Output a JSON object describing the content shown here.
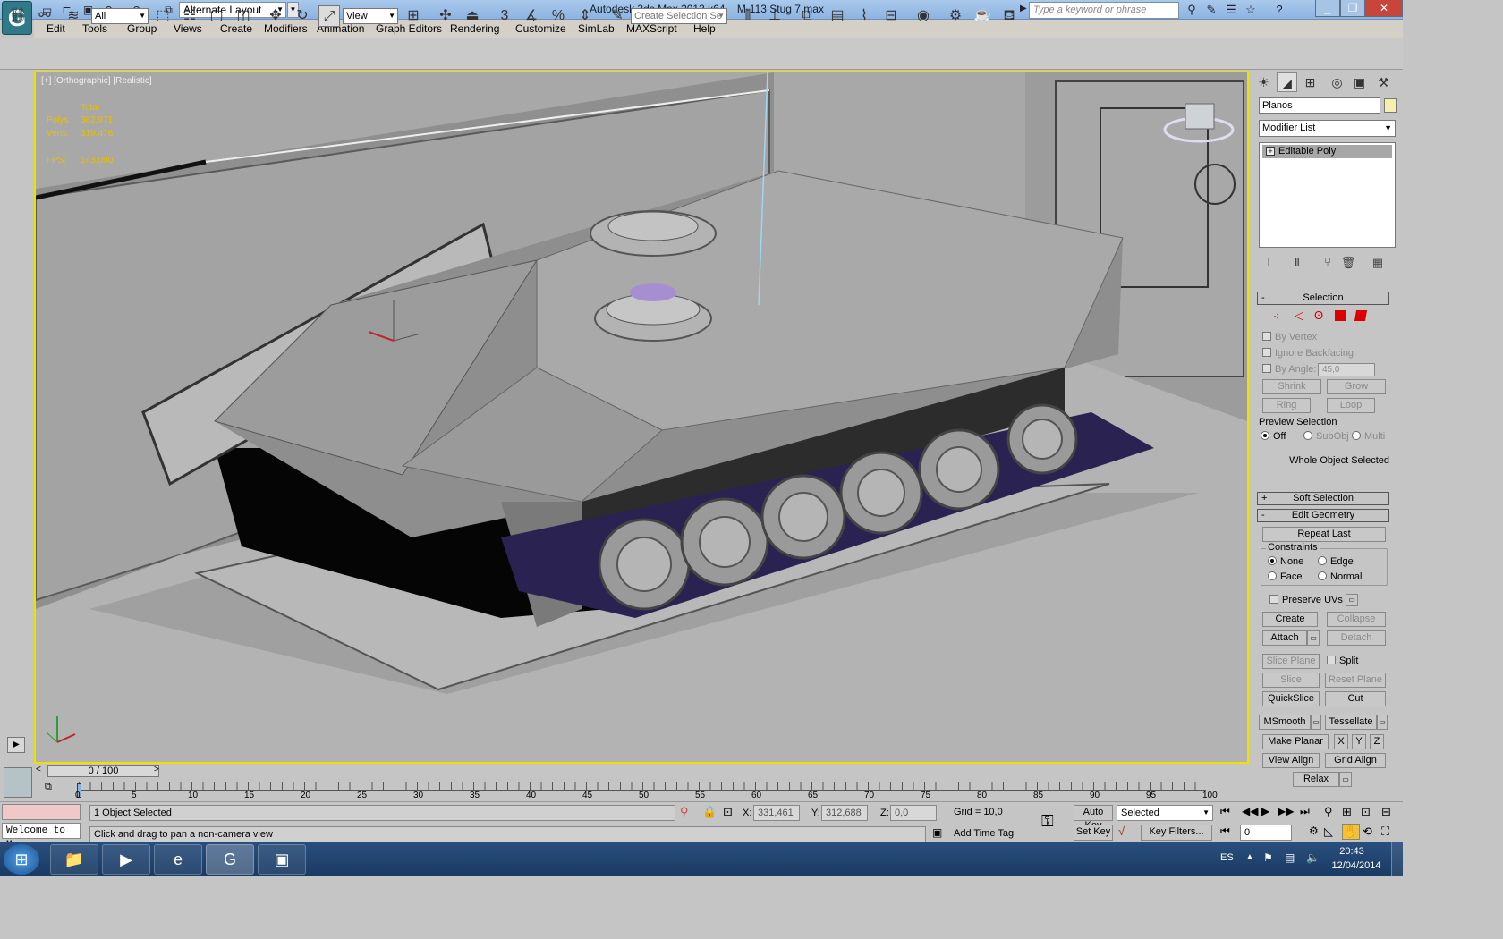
{
  "titlebar": {
    "workspace": "Alternate Layout",
    "app_title": "Autodesk 3ds Max  2013 x64",
    "file_title": "M-113 Stug 7.max",
    "search_placeholder": "Type a keyword or phrase"
  },
  "menu": [
    "Edit",
    "Tools",
    "Group",
    "Views",
    "Create",
    "Modifiers",
    "Animation",
    "Graph Editors",
    "Rendering",
    "Customize",
    "SimLab",
    "MAXScript",
    "Help"
  ],
  "toolbar": {
    "filter": "All",
    "ref_coord": "View",
    "named_selection": "Create Selection Se"
  },
  "viewport": {
    "label": "[+] [Orthographic] [Realistic]",
    "stats": {
      "total_label": "Total",
      "polys_label": "Polys:",
      "polys_value": "362.971",
      "verts_label": "Verts:",
      "verts_value": "319.476",
      "fps_label": "FPS:",
      "fps_value": "143,090"
    }
  },
  "panel": {
    "object_name": "Planos",
    "modifier_list": "Modifier List",
    "stack_item": "Editable Poly",
    "selection": {
      "title": "Selection",
      "by_vertex": "By Vertex",
      "ignore_backfacing": "Ignore Backfacing",
      "by_angle": "By Angle:",
      "angle_value": "45,0",
      "shrink": "Shrink",
      "grow": "Grow",
      "ring": "Ring",
      "loop": "Loop",
      "preview_title": "Preview Selection",
      "off": "Off",
      "subobj": "SubObj",
      "multi": "Multi",
      "status": "Whole Object Selected"
    },
    "soft_selection": "Soft Selection",
    "edit_geometry": {
      "title": "Edit Geometry",
      "repeat_last": "Repeat Last",
      "constraints": "Constraints",
      "none": "None",
      "edge": "Edge",
      "face": "Face",
      "normal": "Normal",
      "preserve_uvs": "Preserve UVs",
      "create": "Create",
      "collapse": "Collapse",
      "attach": "Attach",
      "detach": "Detach",
      "slice_plane": "Slice Plane",
      "split": "Split",
      "slice": "Slice",
      "reset_plane": "Reset Plane",
      "quickslice": "QuickSlice",
      "cut": "Cut",
      "msmooth": "MSmooth",
      "tessellate": "Tessellate",
      "make_planar": "Make Planar",
      "x": "X",
      "y": "Y",
      "z": "Z",
      "view_align": "View Align",
      "grid_align": "Grid Align",
      "relax": "Relax"
    }
  },
  "timeline": {
    "frame": "0 / 100",
    "ticks": [
      "0",
      "5",
      "10",
      "15",
      "20",
      "25",
      "30",
      "35",
      "40",
      "45",
      "50",
      "55",
      "60",
      "65",
      "70",
      "75",
      "80",
      "85",
      "90",
      "95",
      "100"
    ]
  },
  "status": {
    "maxscript": "Welcome to M:",
    "selected": "1 Object Selected",
    "prompt": "Click and drag to pan a non-camera view",
    "x_label": "X:",
    "x_value": "331,461",
    "y_label": "Y:",
    "y_value": "312,688",
    "z_label": "Z:",
    "z_value": "0,0",
    "grid": "Grid = 10,0",
    "add_time_tag": "Add Time Tag",
    "auto_key": "Auto Key",
    "set_key": "Set Key",
    "key_mode": "Selected",
    "key_filters": "Key Filters...",
    "frame_field": "0"
  },
  "taskbar": {
    "lang": "ES",
    "time": "20:43",
    "date": "12/04/2014"
  },
  "colors": {
    "viewport_border": "#f0e000",
    "stats_text": "#e8c000",
    "titlebar": "#9dbfe6"
  }
}
